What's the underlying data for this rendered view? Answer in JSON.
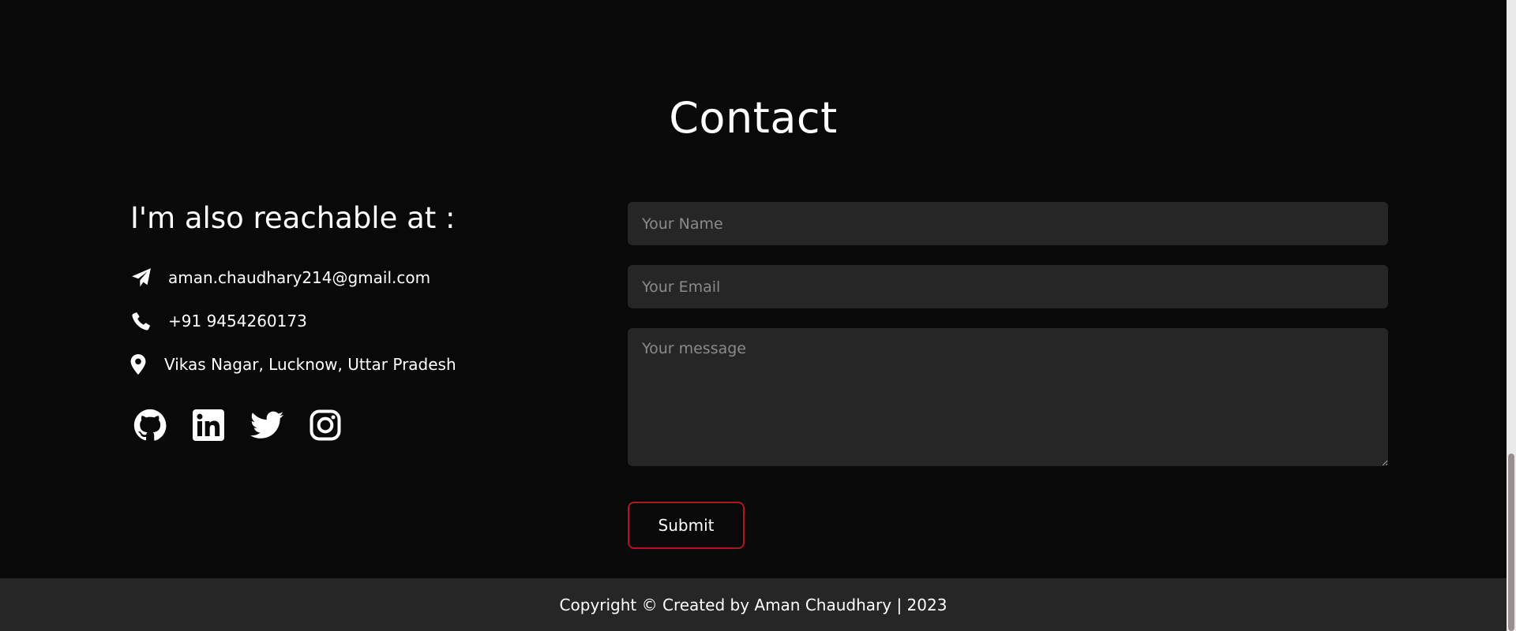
{
  "contact": {
    "title": "Contact",
    "reach_heading": "I'm also reachable at :",
    "email": "aman.chaudhary214@gmail.com",
    "phone": "+91 9454260173",
    "location": "Vikas Nagar, Lucknow, Uttar Pradesh",
    "socials": [
      "github-icon",
      "linkedin-icon",
      "twitter-icon",
      "instagram-icon"
    ]
  },
  "form": {
    "name_placeholder": "Your Name",
    "email_placeholder": "Your Email",
    "message_placeholder": "Your message",
    "submit_label": "Submit"
  },
  "footer": {
    "text": "Copyright © Created by Aman Chaudhary | 2023"
  },
  "colors": {
    "background": "#090909",
    "field_background": "#262626",
    "accent": "#b3151c",
    "footer_background": "#262626"
  }
}
